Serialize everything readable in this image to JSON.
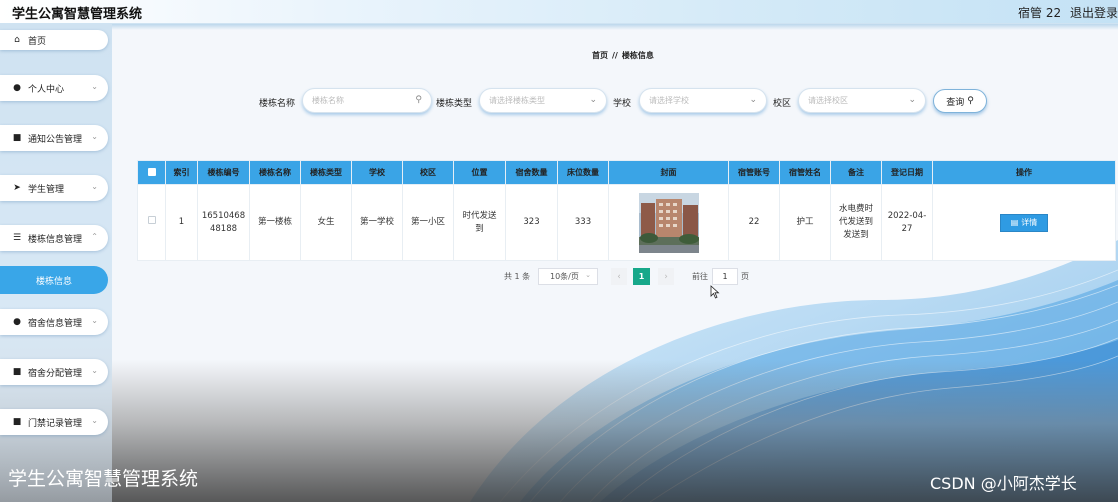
{
  "header": {
    "app_title": "学生公寓智慧管理系统",
    "user_role": "宿管 22",
    "logout_label": "退出登录"
  },
  "sidebar": {
    "items": [
      {
        "label": "首页",
        "icon": "home-icon"
      },
      {
        "label": "个人中心",
        "icon": "user-icon"
      },
      {
        "label": "通知公告管理",
        "icon": "grid-icon"
      },
      {
        "label": "学生管理",
        "icon": "send-icon"
      },
      {
        "label": "楼栋信息管理",
        "icon": "sliders-icon"
      },
      {
        "label": "宿舍信息管理",
        "icon": "user-icon"
      },
      {
        "label": "宿舍分配管理",
        "icon": "grid-icon"
      },
      {
        "label": "门禁记录管理",
        "icon": "grid-icon"
      }
    ],
    "active_sub": "楼栋信息"
  },
  "breadcrumb": {
    "home": "首页",
    "separator": "//",
    "current": "楼栋信息"
  },
  "search": {
    "name_label": "楼栋名称",
    "name_placeholder": "楼栋名称",
    "type_label": "楼栋类型",
    "type_placeholder": "请选择楼栋类型",
    "school_label": "学校",
    "school_placeholder": "请选择学校",
    "campus_label": "校区",
    "campus_placeholder": "请选择校区",
    "query_button": "查询"
  },
  "table": {
    "columns": [
      "索引",
      "楼栋编号",
      "楼栋名称",
      "楼栋类型",
      "学校",
      "校区",
      "位置",
      "宿舍数量",
      "床位数量",
      "封面",
      "宿管账号",
      "宿管姓名",
      "备注",
      "登记日期",
      "操作"
    ],
    "rows": [
      {
        "index": "1",
        "building_no": "1651046848188",
        "building_name": "第一楼栋",
        "building_type": "女生",
        "school": "第一学校",
        "campus": "第一小区",
        "location": "时代发送到",
        "dorm_count": "323",
        "bed_count": "333",
        "manager_account": "22",
        "manager_name": "护工",
        "remark": "水电费时代发送到发送到",
        "register_date": "2022-04-27",
        "action_label": "详情"
      }
    ]
  },
  "pagination": {
    "total_text": "共 1 条",
    "page_size": "10条/页",
    "current_page": "1",
    "goto_label": "前往",
    "goto_value": "1",
    "page_unit": "页"
  },
  "footer": {
    "title": "学生公寓智慧管理系统",
    "watermark": "CSDN @小阿杰学长"
  },
  "colors": {
    "accent": "#3aa4e6",
    "active_page": "#17a88a",
    "sidebar_active": "#39a6e8"
  }
}
